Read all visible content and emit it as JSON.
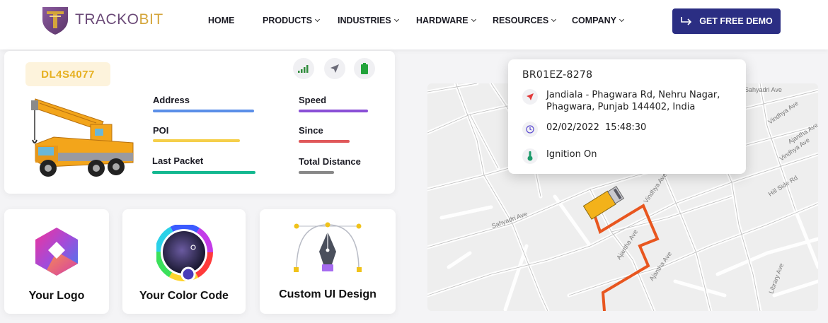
{
  "brand": {
    "name_part1": "TRACKO",
    "name_part2": "BIT",
    "logo_color": "#6b4a78",
    "accent_color": "#d4a53a"
  },
  "nav": {
    "items": [
      {
        "label": "HOME",
        "has_dropdown": false
      },
      {
        "label": "PRODUCTS",
        "has_dropdown": true
      },
      {
        "label": "INDUSTRIES",
        "has_dropdown": true
      },
      {
        "label": "HARDWARE",
        "has_dropdown": true
      },
      {
        "label": "RESOURCES",
        "has_dropdown": true
      },
      {
        "label": "COMPANY",
        "has_dropdown": true
      }
    ],
    "cta_label": "GET FREE DEMO",
    "cta_color": "#2b2e83"
  },
  "vehicle": {
    "plate": "DL4S4077",
    "status_icons": [
      "signal-icon",
      "navigation-icon",
      "battery-icon"
    ],
    "fields": [
      {
        "label": "Address",
        "color": "#5b8fe8"
      },
      {
        "label": "POI",
        "color": "#f5cf4a"
      },
      {
        "label": "Last Packet",
        "color": "#14b890"
      },
      {
        "label": "Speed",
        "color": "#8a4fd6"
      },
      {
        "label": "Since",
        "color": "#e0585a"
      },
      {
        "label": "Total Distance",
        "color": "#888888"
      }
    ]
  },
  "features": [
    {
      "label": "Your Logo",
      "icon": "logo-app-icon"
    },
    {
      "label": "Your Color Code",
      "icon": "color-wheel-icon"
    },
    {
      "label": "Custom UI Design",
      "icon": "pen-tool-icon"
    }
  ],
  "map": {
    "street_labels": [
      "Sahyadri Ave",
      "Vindhya Ave",
      "Vindhya Ave",
      "Ajantha Ave",
      "Hill Side Rd",
      "Vindhya Ave",
      "Ajantha Ave",
      "Library Ave",
      "Ajantha Ave",
      "Sahyadri Ave"
    ],
    "route_color": "#e8561f",
    "popup": {
      "vehicle_id": "BR01EZ-8278",
      "address": "Jandiala - Phagwara Rd, Nehru Nagar, Phagwara, Punjab 144402, India",
      "date": "02/02/2022",
      "time": "15:48:30",
      "status": "Ignition On"
    }
  }
}
